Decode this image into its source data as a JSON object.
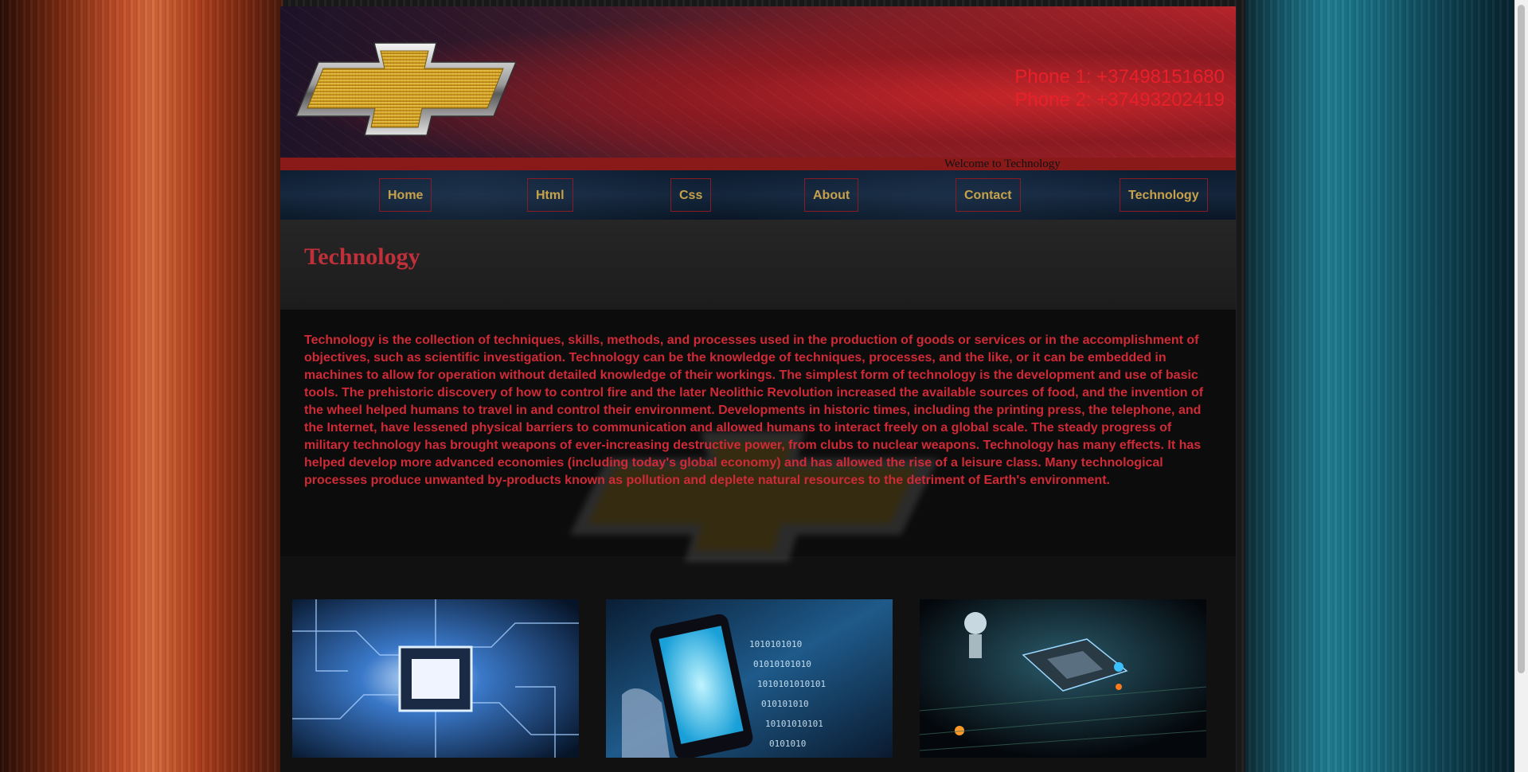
{
  "header": {
    "phone1": "Phone 1: +37498151680",
    "phone2": "Phone 2: +37493202419",
    "welcome": "Welcome to Technology"
  },
  "nav": {
    "items": [
      {
        "label": "Home"
      },
      {
        "label": "Html"
      },
      {
        "label": "Css"
      },
      {
        "label": "About"
      },
      {
        "label": "Contact"
      },
      {
        "label": "Technology"
      }
    ]
  },
  "main": {
    "title": "Technology",
    "body": "Technology is the collection of techniques, skills, methods, and processes used in the production of goods or services or in the accomplishment of objectives, such as scientific investigation. Technology can be the knowledge of techniques, processes, and the like, or it can be embedded in machines to allow for operation without detailed knowledge of their workings. The simplest form of technology is the development and use of basic tools. The prehistoric discovery of how to control fire and the later Neolithic Revolution increased the available sources of food, and the invention of the wheel helped humans to travel in and control their environment. Developments in historic times, including the printing press, the telephone, and the Internet, have lessened physical barriers to communication and allowed humans to interact freely on a global scale. The steady progress of military technology has brought weapons of ever-increasing destructive power, from clubs to nuclear weapons. Technology has many effects. It has helped develop more advanced economies (including today's global economy) and has allowed the rise of a leisure class. Many technological processes produce unwanted by-products known as pollution and deplete natural resources to the detriment of Earth's environment."
  },
  "gallery": {
    "images": [
      "circuit-chip-image",
      "smartphone-binary-image",
      "robot-processor-image"
    ]
  },
  "colors": {
    "accent_red": "#d02a36",
    "nav_text": "#c8a24a",
    "phone_red": "#e8202a"
  }
}
